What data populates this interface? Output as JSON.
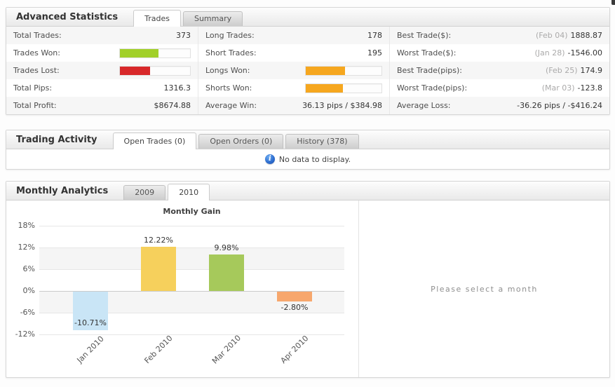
{
  "advanced_statistics": {
    "title": "Advanced Statistics",
    "tabs": [
      {
        "label": "Trades",
        "active": true
      },
      {
        "label": "Summary",
        "active": false
      }
    ],
    "columns": [
      {
        "rows": [
          {
            "label": "Total Trades:",
            "value": "373"
          },
          {
            "label": "Trades Won:",
            "bar": {
              "color": "#a2d029",
              "percent": 55
            }
          },
          {
            "label": "Trades Lost:",
            "bar": {
              "color": "#d8282a",
              "percent": 43
            }
          },
          {
            "label": "Total Pips:",
            "value": "1316.3"
          },
          {
            "label": "Total Profit:",
            "value": "$8674.88"
          }
        ]
      },
      {
        "rows": [
          {
            "label": "Long Trades:",
            "value": "178"
          },
          {
            "label": "Short Trades:",
            "value": "195"
          },
          {
            "label": "Longs Won:",
            "bar": {
              "color": "#f6a71f",
              "percent": 52
            }
          },
          {
            "label": "Shorts Won:",
            "bar": {
              "color": "#f6a71f",
              "percent": 49
            }
          },
          {
            "label": "Average Win:",
            "value": "36.13 pips / $384.98"
          }
        ]
      },
      {
        "rows": [
          {
            "label": "Best Trade($):",
            "date": "(Feb 04)",
            "value": "1888.87"
          },
          {
            "label": "Worst Trade($):",
            "date": "(Jan 28)",
            "value": "-1546.00"
          },
          {
            "label": "Best Trade(pips):",
            "date": "(Feb 25)",
            "value": "174.9"
          },
          {
            "label": "Worst Trade(pips):",
            "date": "(Mar 03)",
            "value": "-123.8"
          },
          {
            "label": "Average Loss:",
            "value": "-36.26 pips / -$416.24"
          }
        ]
      }
    ]
  },
  "trading_activity": {
    "title": "Trading Activity",
    "tabs": [
      {
        "label": "Open Trades (0)",
        "active": true
      },
      {
        "label": "Open Orders (0)",
        "active": false
      },
      {
        "label": "History (378)",
        "active": false
      }
    ],
    "empty_message": "No data to display.",
    "info_icon": "info-icon"
  },
  "monthly_analytics": {
    "title": "Monthly Analytics",
    "tabs": [
      {
        "label": "2009",
        "active": false
      },
      {
        "label": "2010",
        "active": true
      }
    ],
    "side_panel_message": "Please select a month"
  },
  "chart_data": {
    "type": "bar",
    "title": "Monthly Gain",
    "categories": [
      "Jan 2010",
      "Feb 2010",
      "Mar 2010",
      "Apr 2010"
    ],
    "values": [
      -10.71,
      12.22,
      9.98,
      -2.8
    ],
    "value_labels": [
      "-10.71%",
      "12.22%",
      "9.98%",
      "-2.80%"
    ],
    "bar_colors": [
      "#c9e5f6",
      "#f6d05c",
      "#a6c95b",
      "#f7a76d"
    ],
    "xlabel": "",
    "ylabel": "",
    "ylim": [
      -12,
      18
    ],
    "yticks": [
      18,
      12,
      6,
      0,
      -6,
      -12
    ],
    "ytick_labels": [
      "18%",
      "12%",
      "6%",
      "0%",
      "-6%",
      "-12%"
    ],
    "grid": true,
    "legend": false,
    "band_ranges": [
      [
        6,
        12
      ],
      [
        -6,
        0
      ]
    ],
    "colors": {
      "band": "#f5f5f5",
      "gridline": "#e6e6e6",
      "zero_line": "#cbcbcb"
    }
  }
}
